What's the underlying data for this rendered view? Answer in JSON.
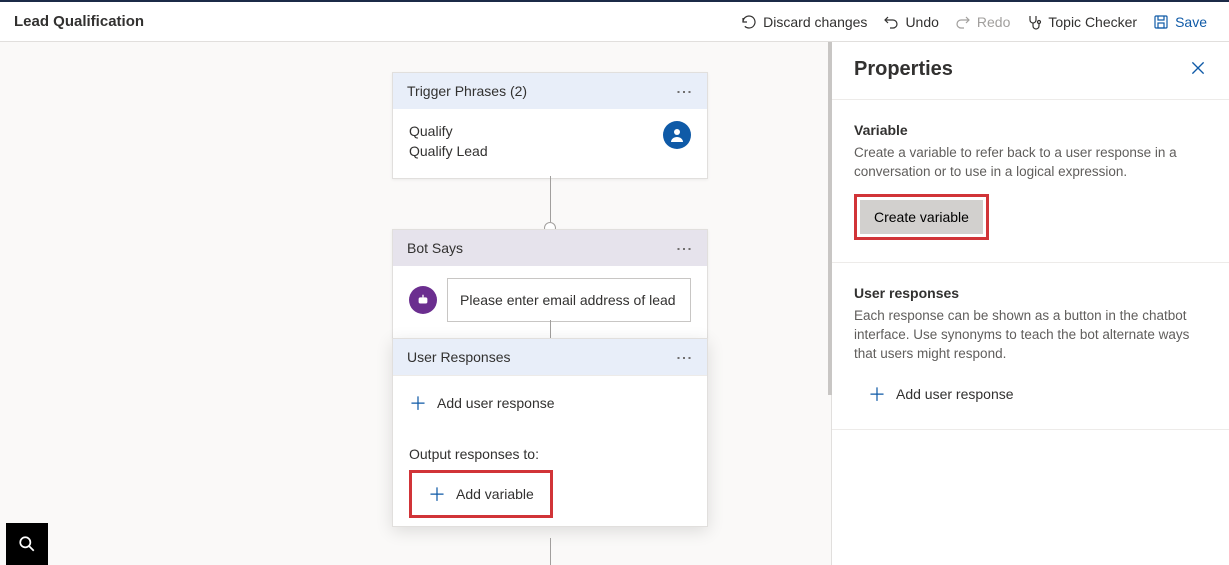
{
  "title": "Lead Qualification",
  "toolbar": {
    "discard": "Discard changes",
    "undo": "Undo",
    "redo": "Redo",
    "topic_checker": "Topic Checker",
    "save": "Save"
  },
  "canvas": {
    "trigger": {
      "header": "Trigger Phrases (2)",
      "phrases": [
        "Qualify",
        "Qualify Lead"
      ]
    },
    "bot_says": {
      "header": "Bot Says",
      "message": "Please enter email address of lead"
    },
    "user_responses": {
      "header": "User Responses",
      "add_response": "Add user response",
      "output_label": "Output responses to:",
      "add_variable": "Add variable"
    }
  },
  "panel": {
    "title": "Properties",
    "variable": {
      "heading": "Variable",
      "description": "Create a variable to refer back to a user response in a conversation or to use in a logical expression.",
      "button": "Create variable"
    },
    "user_responses": {
      "heading": "User responses",
      "description": "Each response can be shown as a button in the chatbot interface. Use synonyms to teach the bot alternate ways that users might respond.",
      "add_response": "Add user response"
    }
  }
}
